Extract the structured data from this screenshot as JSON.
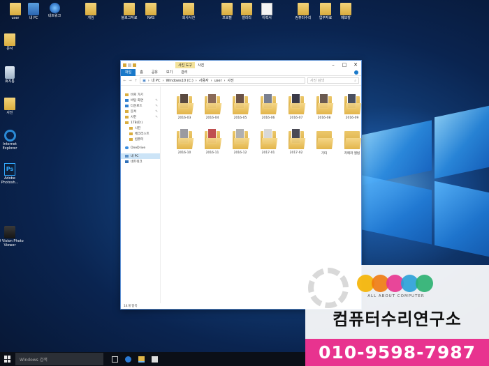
{
  "desktop": {
    "top_icons": [
      {
        "label": "user",
        "icon": "folder-user-icon"
      },
      {
        "label": "내 PC",
        "icon": "pc-icon"
      },
      {
        "label": "네트워크",
        "icon": "network-icon"
      },
      {
        "label": "게임",
        "icon": "folder-icon"
      },
      {
        "label": "블로그자료",
        "icon": "folder-icon"
      },
      {
        "label": "NAS",
        "icon": "folder-icon"
      },
      {
        "label": "회사사진",
        "icon": "folder-icon"
      },
      {
        "label": "프로필",
        "icon": "folder-icon"
      },
      {
        "label": "갤러리",
        "icon": "folder-icon"
      },
      {
        "label": "이력서",
        "icon": "document-icon"
      },
      {
        "label": "컴퓨터수리",
        "icon": "folder-icon"
      },
      {
        "label": "업무자료",
        "icon": "folder-icon"
      },
      {
        "label": "메모장",
        "icon": "folder-icon"
      }
    ],
    "left_icons": [
      {
        "label": "문서",
        "icon": "folder-icon"
      },
      {
        "label": "휴지통",
        "icon": "recycle-bin-icon"
      },
      {
        "label": "사진",
        "icon": "folder-icon"
      },
      {
        "label": "Internet Explorer",
        "icon": "internet-explorer-icon"
      },
      {
        "label": "Adobe Photosh...",
        "icon": "photoshop-icon"
      },
      {
        "label": "3D Vision Photo Viewer",
        "icon": "photo-viewer-icon"
      }
    ]
  },
  "explorer": {
    "context_tab": "사진 도구",
    "title": "사진",
    "ribbon_tabs": [
      "파일",
      "홈",
      "공유",
      "보기",
      "관리"
    ],
    "address_path": [
      "내 PC",
      "Windows10 (C:)",
      "사용자",
      "user",
      "사진"
    ],
    "search_placeholder": "사진 검색",
    "nav_items": [
      {
        "label": "바로 가기",
        "kind": "quick",
        "pinned": false
      },
      {
        "label": "바탕 화면",
        "kind": "blue",
        "pinned": true
      },
      {
        "label": "다운로드",
        "kind": "blue",
        "pinned": true
      },
      {
        "label": "문서",
        "kind": "folder",
        "pinned": true
      },
      {
        "label": "사진",
        "kind": "folder",
        "pinned": true
      },
      {
        "label": "1TB(D:)",
        "kind": "folder",
        "pinned": false
      },
      {
        "label": "사진",
        "kind": "folder",
        "pinned": false
      },
      {
        "label": "체크리스트",
        "kind": "folder",
        "pinned": false
      },
      {
        "label": "컴퓨터",
        "kind": "folder",
        "pinned": false
      },
      {
        "label": "OneDrive",
        "kind": "cloud",
        "pinned": false
      },
      {
        "label": "내 PC",
        "kind": "pc",
        "pinned": false
      },
      {
        "label": "네트워크",
        "kind": "net",
        "pinned": false
      }
    ],
    "folders": [
      {
        "label": "2016-03",
        "photo": "#5a4a40"
      },
      {
        "label": "2016-04",
        "photo": "#8a6a58"
      },
      {
        "label": "2016-05",
        "photo": "#6a5248"
      },
      {
        "label": "2016-06",
        "photo": "#7a8090"
      },
      {
        "label": "2016-07",
        "photo": "#3a3a48"
      },
      {
        "label": "2016-08",
        "photo": "#6a5a50"
      },
      {
        "label": "2016-09",
        "photo": "#4a5060"
      },
      {
        "label": "2016-10",
        "photo": "#9a9aa0"
      },
      {
        "label": "2016-11",
        "photo": "#c05050"
      },
      {
        "label": "2016-12",
        "photo": "#b0b0b0"
      },
      {
        "label": "2017-01",
        "photo": "#d8d8d8"
      },
      {
        "label": "2017-02",
        "photo": "#4a4a55"
      },
      {
        "label": "기타",
        "photo": ""
      },
      {
        "label": "카메라 앨범",
        "photo": ""
      }
    ],
    "status_text": "14개 항목"
  },
  "taskbar": {
    "search_placeholder": "Windows 검색"
  },
  "ad": {
    "tagline": "ALL ABOUT COMPUTER",
    "name": "컴퓨터수리연구소",
    "phone": "010-9598-7987",
    "circle_colors": [
      "#f5b300",
      "#f07a10",
      "#e8338f",
      "#2aa0d8",
      "#2ab070"
    ]
  },
  "colors": {
    "accent": "#1979ca",
    "ad_pink": "#e8338f"
  }
}
